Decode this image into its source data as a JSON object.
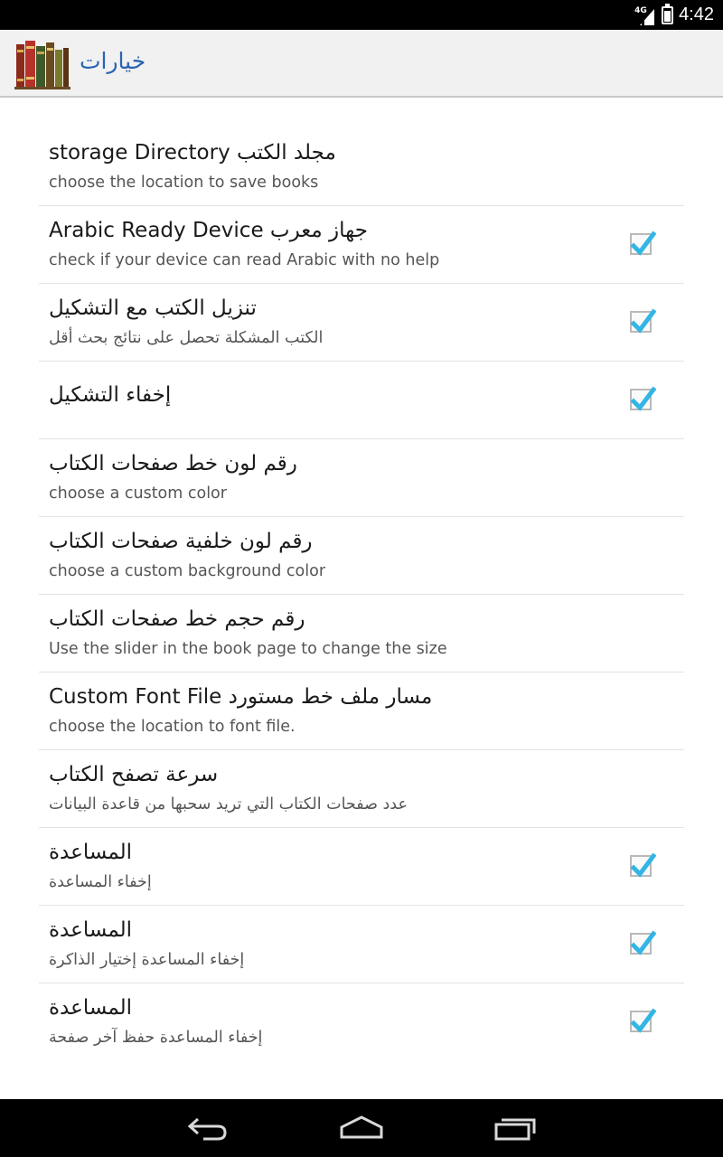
{
  "status_bar": {
    "network": "4G",
    "time": "4:42"
  },
  "action_bar": {
    "icon": "bookshelf-icon",
    "title": "خيارات"
  },
  "preferences": [
    {
      "title": "storage Directory مجلد الكتب",
      "summary": "choose the location to save books",
      "checkbox": false
    },
    {
      "title": "Arabic Ready Device جهاز معرب",
      "summary": "check if your device can read Arabic with no help",
      "checkbox": true,
      "checked": true
    },
    {
      "title": "تنزيل الكتب مع التشكيل",
      "summary": "الكتب المشكلة تحصل على نتائج بحث أقل",
      "checkbox": true,
      "checked": true
    },
    {
      "title": "إخفاء التشكيل",
      "summary": "",
      "checkbox": true,
      "checked": true
    },
    {
      "title": "رقم لون خط صفحات الكتاب",
      "summary": "choose a custom color",
      "checkbox": false
    },
    {
      "title": "رقم لون خلفية صفحات الكتاب",
      "summary": "choose a custom background color",
      "checkbox": false
    },
    {
      "title": "رقم حجم خط صفحات الكتاب",
      "summary": "Use the slider in the book page to change the size",
      "checkbox": false
    },
    {
      "title": "Custom Font File مسار ملف خط مستورد",
      "summary": "choose the location to font file.",
      "checkbox": false
    },
    {
      "title": "سرعة تصفح الكتاب",
      "summary": "عدد صفحات الكتاب التي تريد سحبها من قاعدة البيانات",
      "checkbox": false
    },
    {
      "title": "المساعدة",
      "summary": "إخفاء المساعدة",
      "checkbox": true,
      "checked": true
    },
    {
      "title": "المساعدة",
      "summary": "إخفاء المساعدة إختيار الذاكرة",
      "checkbox": true,
      "checked": true
    },
    {
      "title": "المساعدة",
      "summary": "إخفاء المساعدة حفظ آخر صفحة",
      "checkbox": true,
      "checked": true
    }
  ],
  "colors": {
    "accent": "#2a64b3",
    "check": "#33b5e5"
  },
  "nav_bar": {
    "back": "back-icon",
    "home": "home-icon",
    "recent": "recent-apps-icon"
  }
}
